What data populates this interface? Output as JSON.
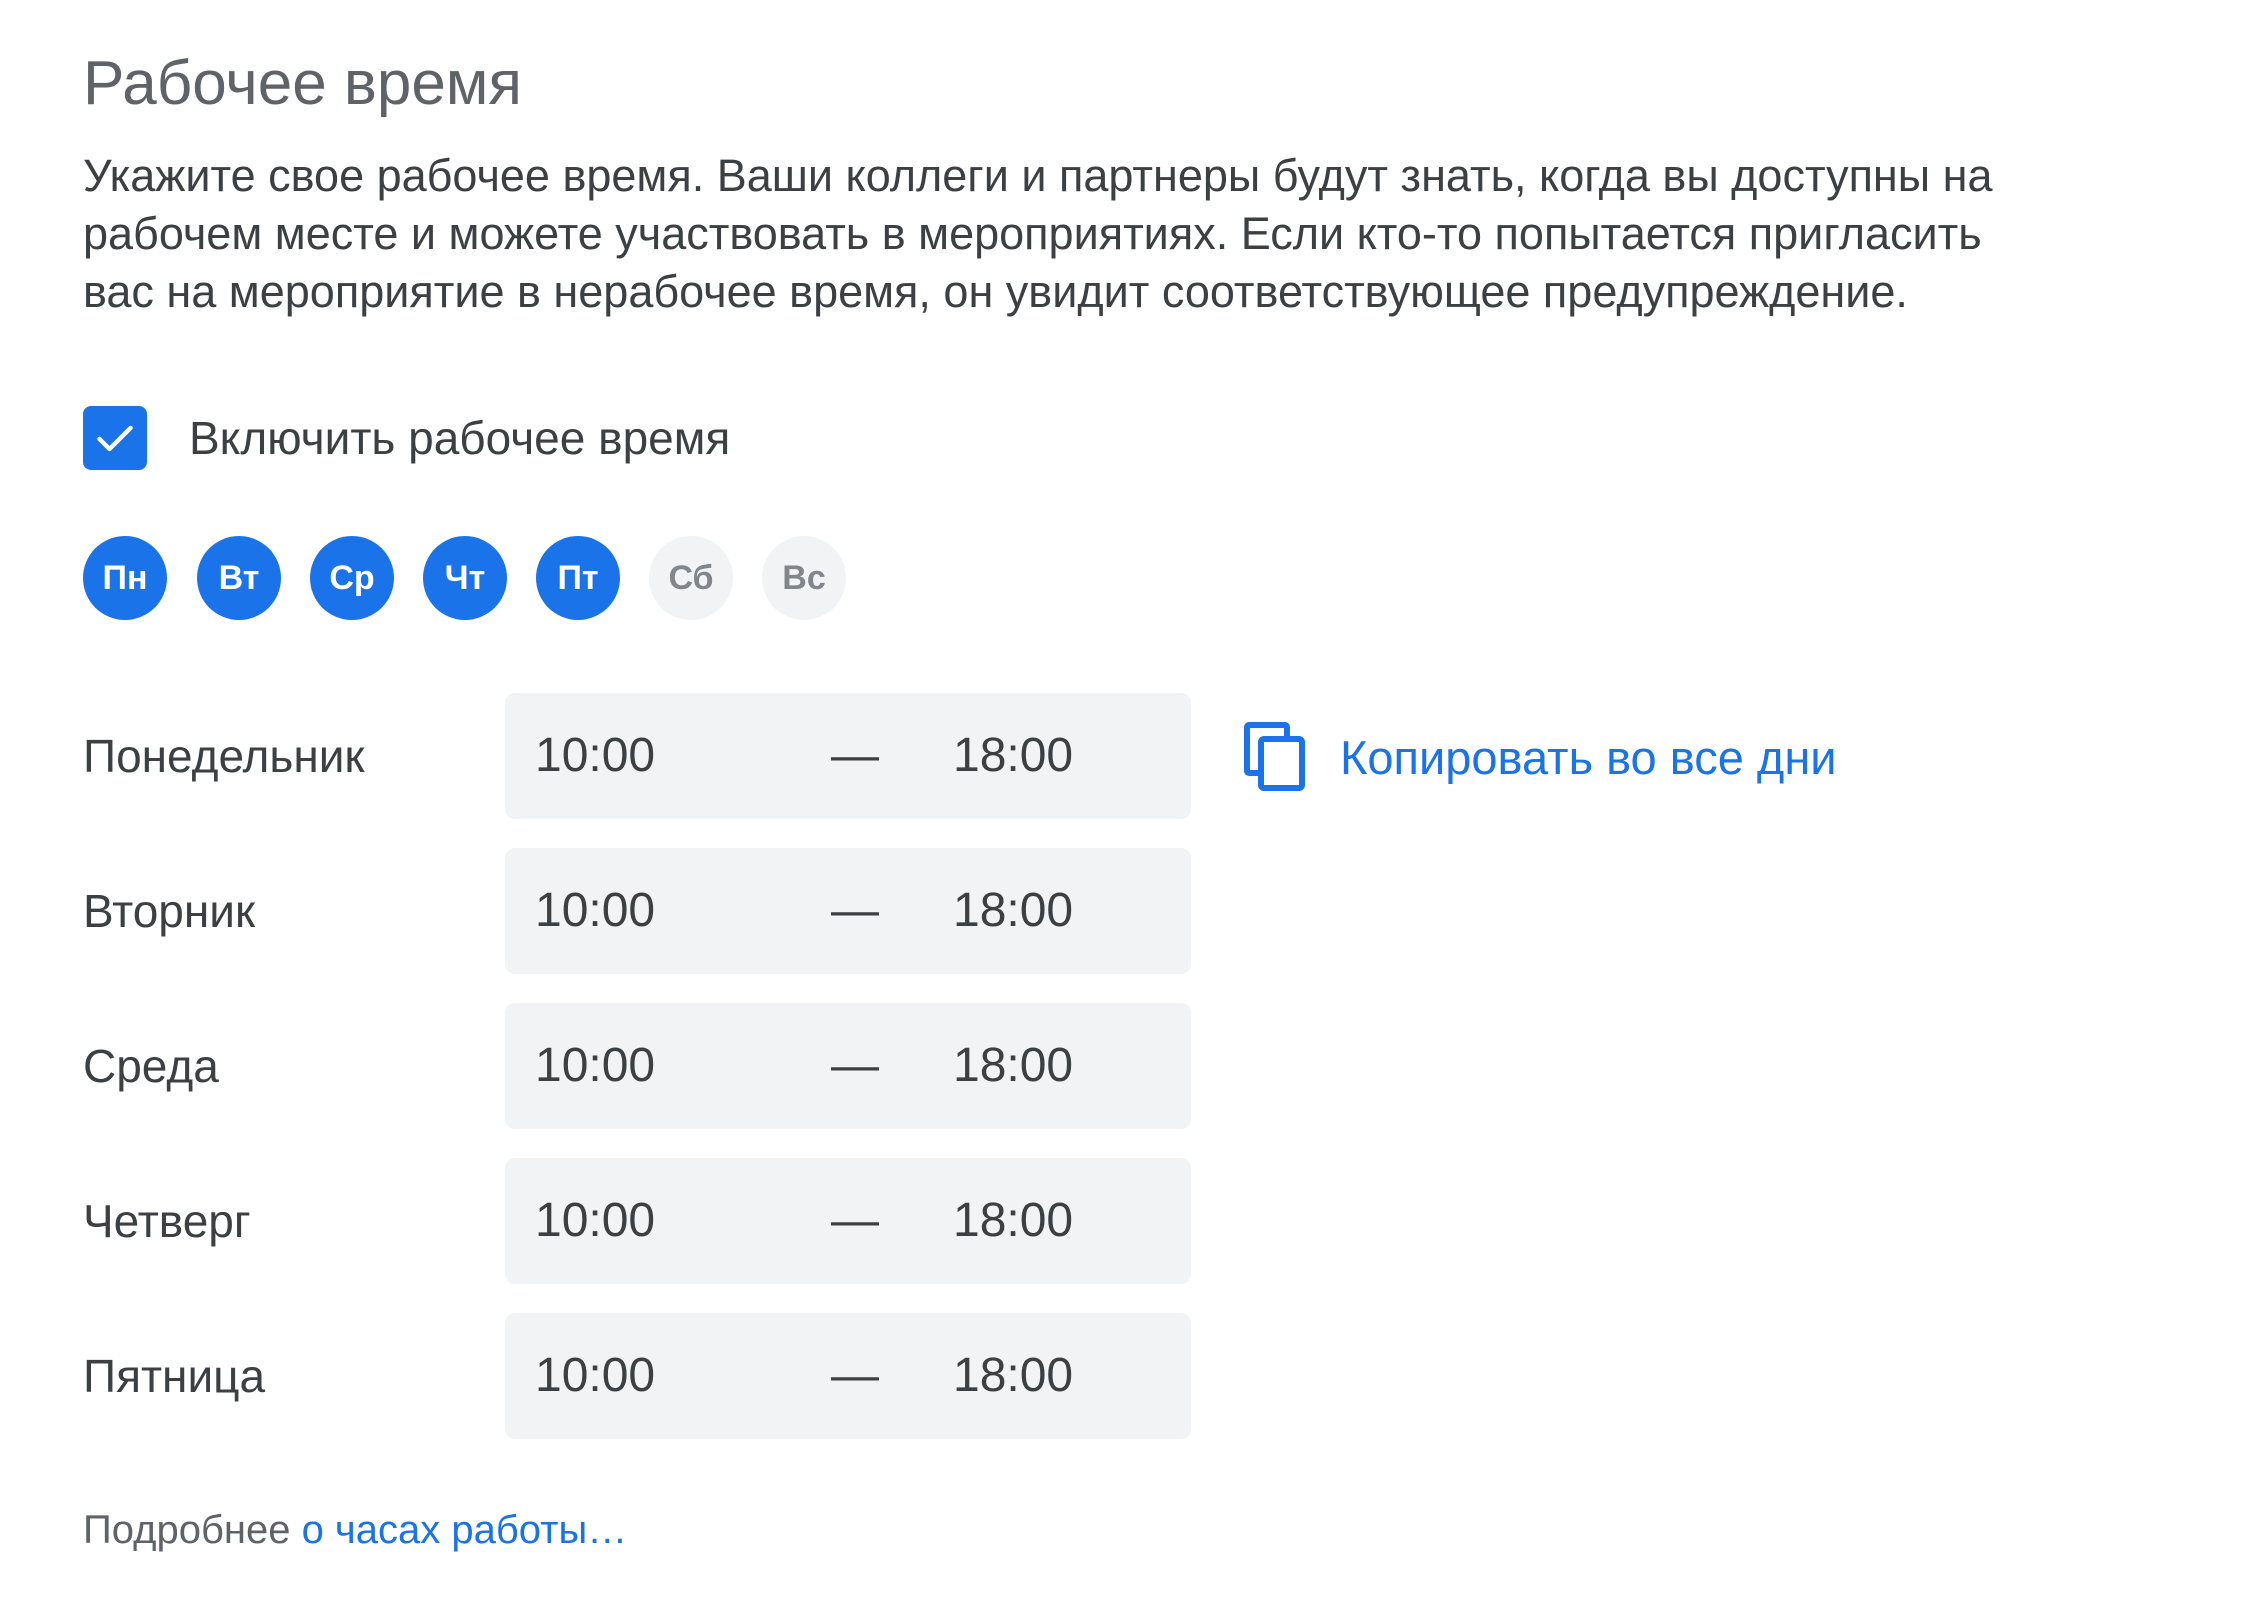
{
  "section": {
    "title": "Рабочее время",
    "description_lines": [
      "Укажите свое рабочее время. Ваши коллеги и партнеры будут знать, когда вы доступны на",
      "рабочем месте и можете участвовать в мероприятиях. Если кто-то попытается пригласить",
      "вас на мероприятие в нерабочее время, он увидит соответствующее предупреждение."
    ]
  },
  "toggle": {
    "label": "Включить рабочее время",
    "checked": true,
    "icon": "checkmark-icon"
  },
  "day_chips": [
    {
      "label": "Пн",
      "selected": true
    },
    {
      "label": "Вт",
      "selected": true
    },
    {
      "label": "Ср",
      "selected": true
    },
    {
      "label": "Чт",
      "selected": true
    },
    {
      "label": "Пт",
      "selected": true
    },
    {
      "label": "Сб",
      "selected": false
    },
    {
      "label": "Вс",
      "selected": false
    }
  ],
  "schedule": [
    {
      "day": "Понедельник",
      "start": "10:00",
      "separator": "—",
      "end": "18:00"
    },
    {
      "day": "Вторник",
      "start": "10:00",
      "separator": "—",
      "end": "18:00"
    },
    {
      "day": "Среда",
      "start": "10:00",
      "separator": "—",
      "end": "18:00"
    },
    {
      "day": "Четверг",
      "start": "10:00",
      "separator": "—",
      "end": "18:00"
    },
    {
      "day": "Пятница",
      "start": "10:00",
      "separator": "—",
      "end": "18:00"
    }
  ],
  "copy_action": {
    "label": "Копировать во все дни",
    "icon": "copy-icon"
  },
  "footer": {
    "prefix": "Подробнее ",
    "link": "о часах работы…"
  },
  "colors": {
    "accent": "#1a73e8",
    "chip_off_bg": "#f1f3f4",
    "text": "#3c4043",
    "muted": "#5f6368"
  }
}
